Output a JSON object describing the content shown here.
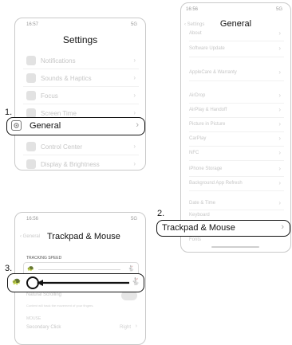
{
  "settings_screen": {
    "time": "16:57",
    "signal": "5G",
    "title": "Settings",
    "items": [
      {
        "label": "Notifications",
        "icon": "bell-icon"
      },
      {
        "label": "Sounds & Haptics",
        "icon": "speaker-icon"
      },
      {
        "label": "Focus",
        "icon": "moon-icon"
      },
      {
        "label": "Screen Time",
        "icon": "hourglass-icon"
      },
      {
        "label": "General",
        "icon": "gear-icon"
      },
      {
        "label": "Control Center",
        "icon": "toggles-icon"
      },
      {
        "label": "Display & Brightness",
        "icon": "sun-icon"
      }
    ]
  },
  "general_screen": {
    "time": "16:56",
    "signal": "5G",
    "back_label": "Settings",
    "title": "General",
    "items": [
      "About",
      "Software Update",
      "AppleCare & Warranty",
      "AirDrop",
      "AirPlay & Handoff",
      "Picture in Picture",
      "CarPlay",
      "NFC",
      "iPhone Storage",
      "Background App Refresh",
      "Date & Time",
      "Keyboard",
      "Trackpad & Mouse",
      "Fonts"
    ]
  },
  "trackpad_screen": {
    "time": "16:56",
    "signal": "5G",
    "back_label": "General",
    "title": "Trackpad & Mouse",
    "section_header": "TRACKING SPEED",
    "natural_scrolling": "Natural Scrolling",
    "natural_scrolling_note": "Content will track the movement of your fingers.",
    "section_mouse": "MOUSE",
    "secondary_click": "Secondary Click",
    "secondary_click_value": "Right"
  },
  "steps": {
    "step1": "1.",
    "step2": "2.",
    "step3": "3."
  }
}
